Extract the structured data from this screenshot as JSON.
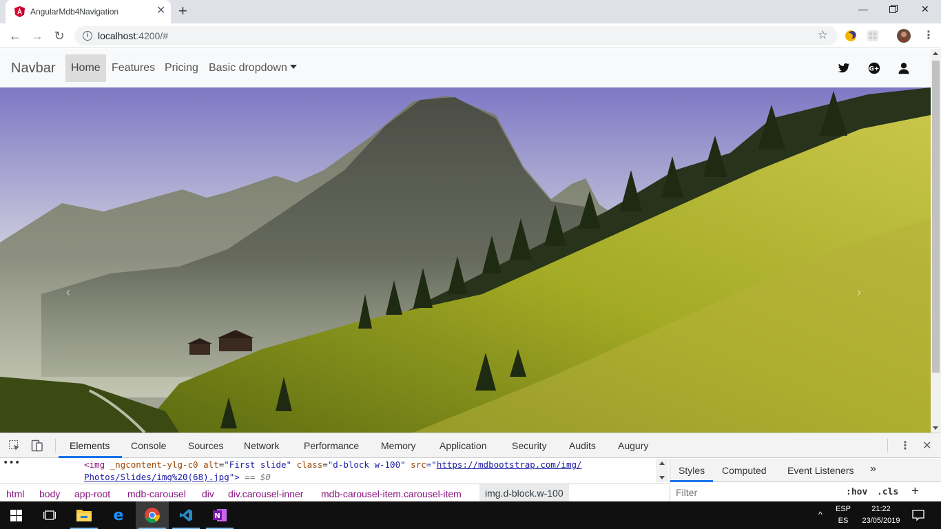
{
  "browser": {
    "tab_title": "AngularMdb4Navigation",
    "url_host": "localhost",
    "url_rest": ":4200/#"
  },
  "navbar": {
    "brand": "Navbar",
    "links": [
      {
        "label": "Home",
        "active": true
      },
      {
        "label": "Features"
      },
      {
        "label": "Pricing"
      },
      {
        "label": "Basic dropdown"
      }
    ],
    "social_icons": [
      "twitter-icon",
      "google-plus-icon",
      "user-icon"
    ]
  },
  "carousel": {
    "prev_glyph": "‹",
    "next_glyph": "›"
  },
  "devtools": {
    "tabs": [
      "Elements",
      "Console",
      "Sources",
      "Network",
      "Performance",
      "Memory",
      "Application",
      "Security",
      "Audits",
      "Augury"
    ],
    "active_tab": "Elements",
    "code": {
      "line1_tag_open": "<img ",
      "line1_attr1": "_ngcontent-ylg-c0",
      "line1_attr2": " alt",
      "line1_val2": "\"First slide\"",
      "line1_attr3": " class",
      "line1_val3": "\"d-block w-100\"",
      "line1_attr4": " src",
      "line1_eq": "=\"",
      "line1_link": "https://mdbootstrap.com/img/",
      "line2_link": "Photos/Slides/img%20(68).jpg",
      "line2_close": "\">",
      "line2_suffix": " == $0"
    },
    "breadcrumbs": [
      "html",
      "body",
      "app-root",
      "mdb-carousel",
      "div",
      "div.carousel-inner",
      "mdb-carousel-item.carousel-item",
      "img.d-block.w-100"
    ],
    "styles_tabs": [
      "Styles",
      "Computed",
      "Event Listeners",
      "»"
    ],
    "filter_placeholder": "Filter",
    "hov": ":hov",
    "cls": ".cls",
    "add": "+"
  },
  "taskbar": {
    "lang_top": "ESP",
    "lang_bottom": "ES",
    "time": "21:22",
    "date": "23/05/2019"
  }
}
